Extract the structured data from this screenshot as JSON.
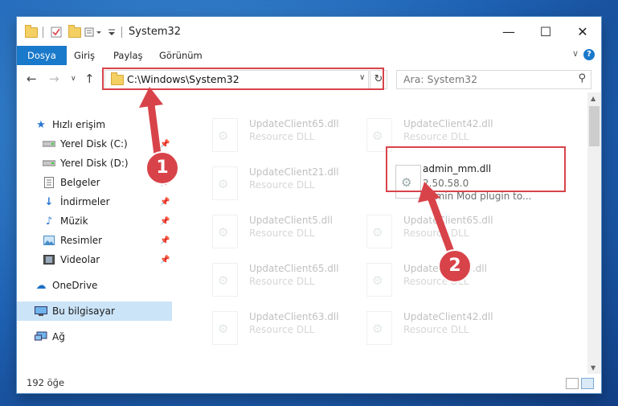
{
  "window": {
    "title": "System32",
    "minimize_icon": "—",
    "maximize_icon": "☐",
    "close_icon": "✕"
  },
  "ribbon": {
    "tabs": [
      "Dosya",
      "Giriş",
      "Paylaş",
      "Görünüm"
    ],
    "active_tab": "Dosya",
    "help_label": "?"
  },
  "address": {
    "path": "C:\\Windows\\System32",
    "caret": "∨",
    "refresh_icon": "↻"
  },
  "search": {
    "placeholder": "Ara: System32"
  },
  "sidebar": {
    "items": [
      {
        "label": "Hızlı erişim",
        "icon": "star-icon"
      },
      {
        "label": "Yerel Disk (C:)",
        "icon": "drive-icon"
      },
      {
        "label": "Yerel Disk (D:)",
        "icon": "drive-icon"
      },
      {
        "label": "Belgeler",
        "icon": "document-icon"
      },
      {
        "label": "İndirmeler",
        "icon": "download-icon"
      },
      {
        "label": "Müzik",
        "icon": "music-icon"
      },
      {
        "label": "Resimler",
        "icon": "picture-icon"
      },
      {
        "label": "Videolar",
        "icon": "video-icon"
      },
      {
        "label": "OneDrive",
        "icon": "cloud-icon"
      },
      {
        "label": "Bu bilgisayar",
        "icon": "computer-icon"
      },
      {
        "label": "Ağ",
        "icon": "network-icon"
      }
    ],
    "selected": "Bu bilgisayar"
  },
  "files": {
    "ghost": [
      {
        "name": "UpdateClient65.dll",
        "type": "Resource DLL"
      },
      {
        "name": "UpdateClient42.dll",
        "type": "Resource DLL"
      },
      {
        "name": "UpdateClient21.dll",
        "type": "Resource DLL"
      },
      {
        "name": "UpdateClient5.dll",
        "type": "Resource DLL"
      },
      {
        "name": "UpdateClient65.dll",
        "type": "Resource DLL"
      },
      {
        "name": "UpdateClient65.dll",
        "type": "Resource DLL"
      },
      {
        "name": "UpdateClient5.dll",
        "type": "Resource DLL"
      },
      {
        "name": "UpdateClient63.dll",
        "type": "Resource DLL"
      },
      {
        "name": "UpdateClient42.dll",
        "type": "Resource DLL"
      }
    ],
    "highlighted": {
      "name": "admin_mm.dll",
      "version": "2.50.58.0",
      "description": "Admin Mod plugin to..."
    }
  },
  "status": {
    "item_count": "192 öğe"
  },
  "callouts": {
    "one": "1",
    "two": "2"
  },
  "colors": {
    "accent": "#1979ca",
    "highlight": "#d8434a",
    "selected": "#cce4f7"
  }
}
